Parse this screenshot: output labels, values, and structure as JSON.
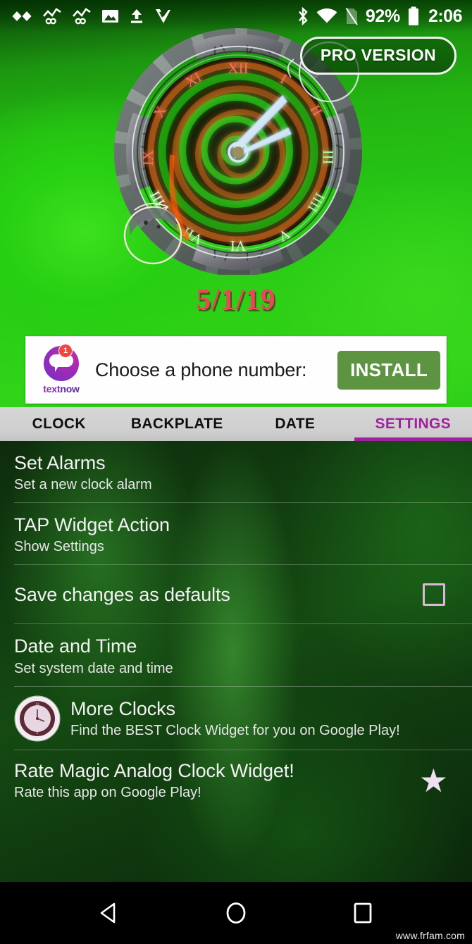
{
  "statusbar": {
    "icons_left": [
      "infinity-icon",
      "graph-infinity-icon",
      "graph-infinity-icon-2",
      "image-icon",
      "upload-icon",
      "check-v-icon"
    ],
    "icons_right": [
      "bluetooth-icon",
      "wifi-icon",
      "no-sim-icon"
    ],
    "battery_percent": "92%",
    "time": "2:06"
  },
  "pro_button": {
    "label": "PRO VERSION"
  },
  "clock_widget": {
    "name": "magic-analog-clock",
    "roman_numerals": [
      "XII",
      "I",
      "II",
      "III",
      "IIII",
      "V",
      "VI",
      "VII",
      "VIII",
      "IX",
      "X",
      "XI"
    ],
    "hour_hand_angle": 52,
    "minute_hand_angle": 78,
    "time_shown": "2:06",
    "colors": {
      "ring": "#8a8a8f",
      "dial_glow_green": "#2fd31a",
      "dial_glow_orange": "#d4641a",
      "numeral_top": "#ef6a52",
      "numeral_bottom": "#b9f5a8"
    }
  },
  "date": {
    "text": "5/1/19",
    "color": "#e8485a"
  },
  "ad": {
    "brand_text_1": "text",
    "brand_text_2": "now",
    "badge_count": "1",
    "headline": "Choose a phone number:",
    "install_label": "INSTALL",
    "install_color": "#5d9442"
  },
  "tabs": {
    "active_color": "#a2219f",
    "items": [
      {
        "label": "CLOCK",
        "active": false
      },
      {
        "label": "BACKPLATE",
        "active": false
      },
      {
        "label": "DATE",
        "active": false
      },
      {
        "label": "SETTINGS",
        "active": true
      }
    ]
  },
  "settings": {
    "rows": [
      {
        "title": "Set Alarms",
        "subtitle": "Set a new clock alarm"
      },
      {
        "title": "TAP Widget Action",
        "subtitle": "Show Settings"
      },
      {
        "title": "Save changes as defaults",
        "subtitle": "",
        "checkbox": "unchecked"
      },
      {
        "title": "Date and Time",
        "subtitle": "Set system date and time"
      },
      {
        "title": "More Clocks",
        "subtitle": "Find the BEST Clock Widget for you on Google Play!",
        "icon": "clock-icon"
      },
      {
        "title": "Rate Magic Analog Clock Widget!",
        "subtitle": "Rate this app on Google Play!",
        "trailing": "star-icon"
      }
    ]
  },
  "navbar": {
    "back": "back-triangle-icon",
    "home": "home-circle-icon",
    "recents": "recents-square-icon"
  },
  "watermark": {
    "text": "www.frfam.com"
  }
}
